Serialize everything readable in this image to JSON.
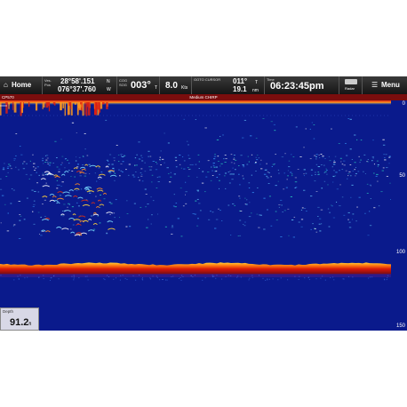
{
  "topbar": {
    "home_label": "Home",
    "pos_label_1": "Ves.",
    "pos_label_2": "Pos",
    "latitude": "28°58'.151",
    "lat_hemi": "N",
    "longitude": "076°37'.760",
    "lon_hemi": "W",
    "cog_label_1": "COG",
    "cog_label_2": "SOG",
    "cog_value": "003°",
    "cog_unit": "T",
    "sog_value": "8.0",
    "sog_unit": "Kts",
    "goto_label": "GOTO CURSOR",
    "goto_bearing": "011°",
    "goto_bearing_unit": "T",
    "goto_distance": "19.1",
    "goto_distance_unit": "nm",
    "time_label": "Time",
    "time_value": "06:23:45pm",
    "radar_label": "Radar",
    "menu_label": "Menu"
  },
  "subbar": {
    "channel": "CP570",
    "mode": "Medium CHIRP"
  },
  "scale": {
    "ticks": [
      "0",
      "50",
      "100",
      "150"
    ]
  },
  "depth": {
    "label": "Depth",
    "value": "91.2",
    "unit": "ft"
  },
  "colors": {
    "water": "#0a1a8c",
    "bottom_return": "#e02010",
    "topbar": "#1c1c1c",
    "subbar": "#7a0d0d"
  }
}
